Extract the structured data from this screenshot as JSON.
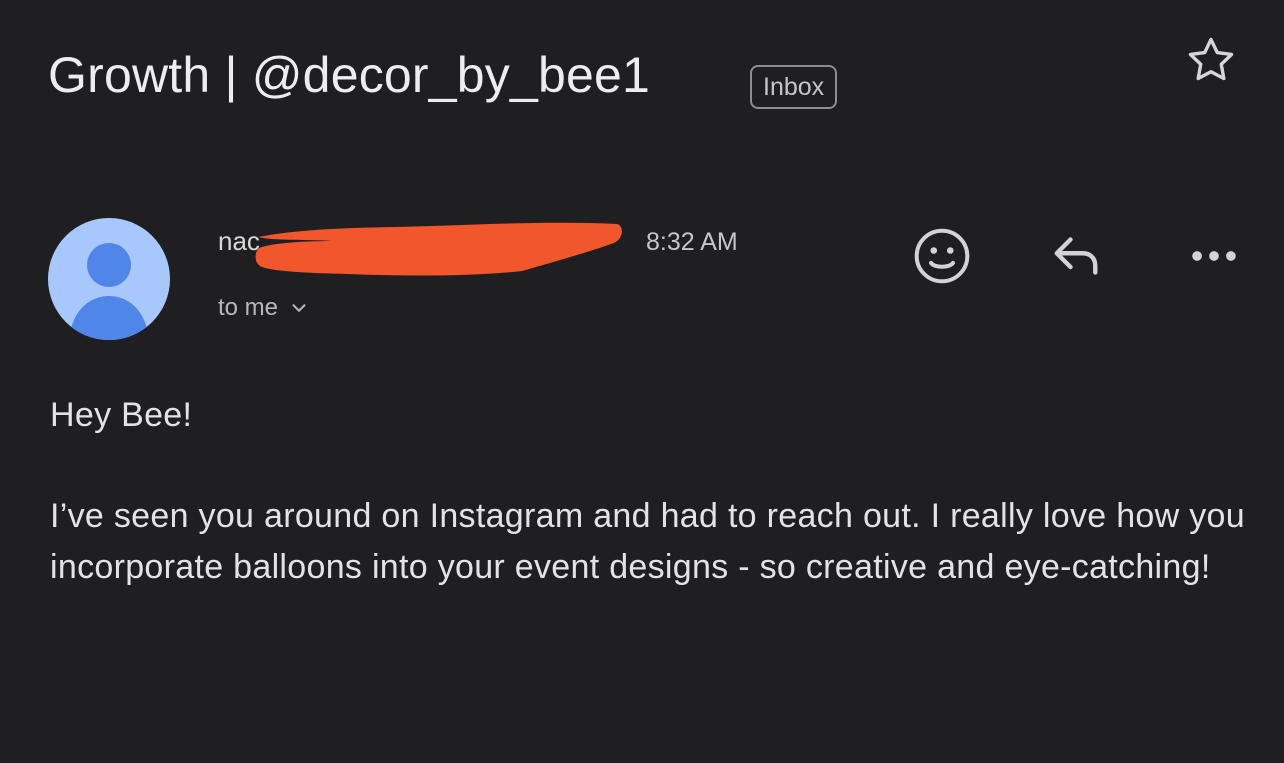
{
  "email": {
    "subject": "Growth | @decor_by_bee1",
    "label": "Inbox",
    "sender_visible": "nac",
    "time": "8:32 AM",
    "recipient": "to me",
    "greeting": "Hey Bee!",
    "body": "I’ve seen you around on Instagram and had to reach out. I really love how you incorporate balloons into your event designs - so creative and eye-catching!"
  },
  "icons": {
    "star": "star-outline-icon",
    "avatar": "person-icon",
    "recipient_expand": "chevron-down-icon",
    "react": "emoji-icon",
    "reply": "reply-arrow-icon",
    "more": "more-horizontal-icon"
  },
  "colors": {
    "background": "#1f1f22",
    "avatar_bg": "#a8c7fa",
    "avatar_fg": "#4f86e8",
    "redaction": "#f2562d"
  }
}
